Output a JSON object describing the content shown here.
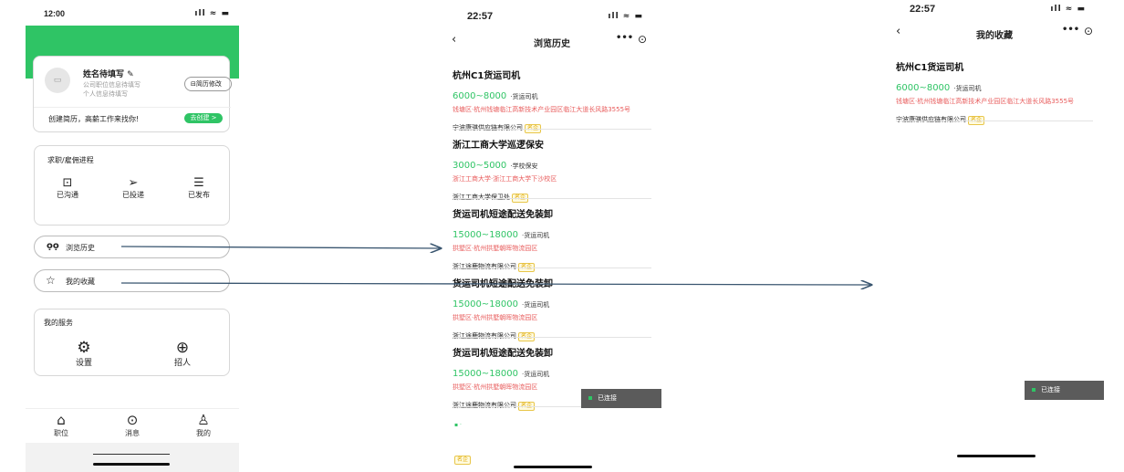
{
  "profile_screen": {
    "status_time": "12:00",
    "user_name": "姓名待填写",
    "user_subtitle_1": "公司职位信息待填写",
    "user_subtitle_2": "个人信息待填写",
    "resume_edit_label": "简历修改",
    "resume_prompt": "创建简历，高薪工作来找你!",
    "create_button": "去创建 >",
    "progress_section_title": "求职/雇佣进程",
    "progress_items": [
      {
        "label": "已沟通",
        "icon": "chat-icon"
      },
      {
        "label": "已投递",
        "icon": "send-icon"
      },
      {
        "label": "已发布",
        "icon": "publish-icon"
      }
    ],
    "history_label": "浏览历史",
    "favorites_label": "我的收藏",
    "services_title": "我的服务",
    "services": [
      {
        "label": "设置",
        "icon": "gear-icon"
      },
      {
        "label": "招人",
        "icon": "add-circle-icon"
      }
    ],
    "tabbar": [
      {
        "label": "职位",
        "icon": "home-icon"
      },
      {
        "label": "消息",
        "icon": "message-icon"
      },
      {
        "label": "我的",
        "icon": "person-icon"
      }
    ]
  },
  "history_screen": {
    "status_time": "22:57",
    "title": "浏览历史",
    "jobs": [
      {
        "title": "杭州C1货运司机",
        "salary": "6000~8000",
        "category": "·货运司机",
        "address": "钱塘区·杭州钱塘临江高新技术产业园区临江大道长风路3555号",
        "company": "宁波康骐供应链有限公司",
        "tag": "名企"
      },
      {
        "title": "浙江工商大学巡逻保安",
        "salary": "3000~5000",
        "category": "·学校保安",
        "address": "浙江工商大学·浙江工商大学下沙校区",
        "company": "浙江工商大学保卫处",
        "tag": "名企"
      },
      {
        "title": "货运司机短途配送免装卸",
        "salary": "15000~18000",
        "category": "·货运司机",
        "address": "拱墅区·杭州拱墅朝晖物流园区",
        "company": "浙江途鹿物流有限公司",
        "tag": "名企"
      },
      {
        "title": "货运司机短途配送免装卸",
        "salary": "15000~18000",
        "category": "·货运司机",
        "address": "拱墅区·杭州拱墅朝晖物流园区",
        "company": "浙江途鹿物流有限公司",
        "tag": "名企"
      },
      {
        "title": "货运司机短途配送免装卸",
        "salary": "15000~18000",
        "category": "·货运司机",
        "address": "拱墅区·杭州拱墅朝晖物流园区",
        "company": "浙江途鹿物流有限公司",
        "tag": "名企"
      }
    ],
    "partial_tag": "名企",
    "toast": "已连接"
  },
  "favorites_screen": {
    "status_time": "22:57",
    "title": "我的收藏",
    "jobs": [
      {
        "title": "杭州C1货运司机",
        "salary": "6000~8000",
        "category": "·货运司机",
        "address": "钱塘区·杭州钱塘临江高新技术产业园区临江大道长风路3555号",
        "company": "宁波康骐供应链有限公司",
        "tag": "名企"
      }
    ],
    "toast": "已连接"
  },
  "colors": {
    "brand_green": "#2fc465",
    "address_red": "#e85b5b",
    "arrow": "#3a5670"
  }
}
